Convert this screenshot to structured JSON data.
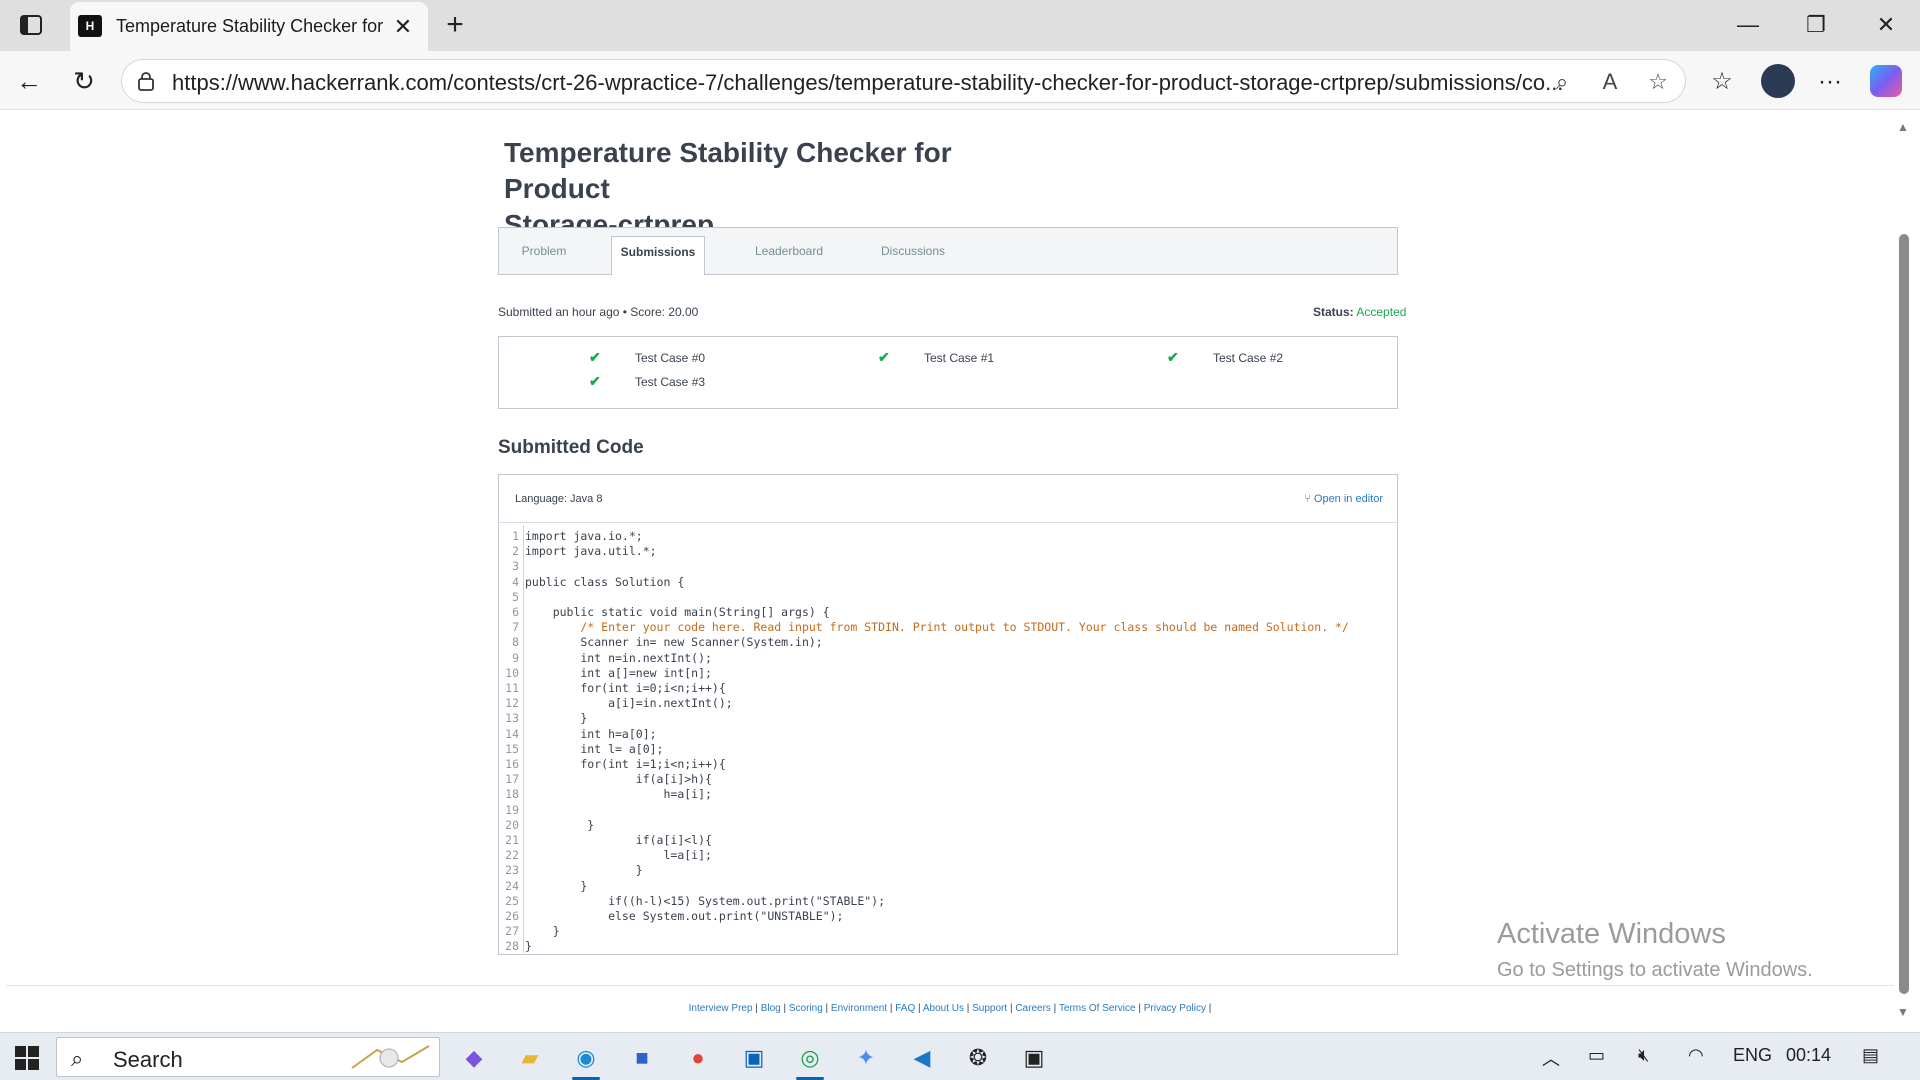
{
  "browser": {
    "tab_title": "Temperature Stability Checker for",
    "url": "https://www.hackerrank.com/contests/crt-26-wpractice-7/challenges/temperature-stability-checker-for-product-storage-crtprep/submissions/co...",
    "favicon_text": "H"
  },
  "page": {
    "title_line1": "Temperature Stability Checker for Product",
    "title_line2": "Storage-crtprep",
    "tabs": [
      {
        "label": "Problem"
      },
      {
        "label": "Submissions"
      },
      {
        "label": "Leaderboard"
      },
      {
        "label": "Discussions"
      }
    ],
    "active_tab": "Submissions",
    "submitted_meta": "Submitted an hour ago • Score: 20.00",
    "status_label": "Status:",
    "status_value": "Accepted",
    "test_cases": [
      {
        "label": "Test Case #0",
        "passed": true
      },
      {
        "label": "Test Case #1",
        "passed": true
      },
      {
        "label": "Test Case #2",
        "passed": true
      },
      {
        "label": "Test Case #3",
        "passed": true
      }
    ],
    "code_heading": "Submitted Code",
    "language": "Language: Java 8",
    "open_in_editor": "Open in editor",
    "code_lines": [
      "import java.io.*;",
      "import java.util.*;",
      "",
      "public class Solution {",
      "",
      "    public static void main(String[] args) {",
      "        /* Enter your code here. Read input from STDIN. Print output to STDOUT. Your class should be named Solution. */",
      "        Scanner in= new Scanner(System.in);",
      "        int n=in.nextInt();",
      "        int a[]=new int[n];",
      "        for(int i=0;i<n;i++){",
      "            a[i]=in.nextInt();",
      "        }",
      "        int h=a[0];",
      "        int l= a[0];",
      "        for(int i=1;i<n;i++){",
      "                if(a[i]>h){",
      "                    h=a[i];",
      "",
      "         }",
      "                if(a[i]<l){",
      "                    l=a[i];",
      "                }",
      "        }",
      "            if((h-l)<15) System.out.print(\"STABLE\");",
      "            else System.out.print(\"UNSTABLE\");",
      "    }",
      "}"
    ],
    "footer_links": [
      "Interview Prep",
      "Blog",
      "Scoring",
      "Environment",
      "FAQ",
      "About Us",
      "Support",
      "Careers",
      "Terms Of Service",
      "Privacy Policy"
    ]
  },
  "watermark": {
    "title": "Activate Windows",
    "subtitle": "Go to Settings to activate Windows."
  },
  "taskbar": {
    "search_placeholder": "Search",
    "language": "ENG",
    "time": "00:14"
  },
  "colors": {
    "accepted": "#1ba94c",
    "link": "#2b7ac0",
    "text": "#39424e"
  }
}
